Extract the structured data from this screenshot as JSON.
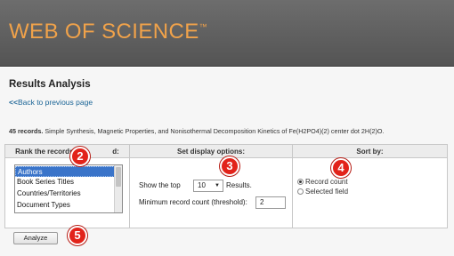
{
  "banner": {
    "title": "WEB OF SCIENCE",
    "trademark": "™"
  },
  "page": {
    "heading": "Results Analysis",
    "back_arrows": "<<",
    "back_link": "Back to previous page"
  },
  "records": {
    "count": "45 records.",
    "title": "Simple Synthesis, Magnetic Properties, and Nonisothermal Decomposition Kinetics of Fe(H2PO4)(2) center dot 2H(2)O."
  },
  "rank": {
    "header_before": "Rank the records by",
    "header_after": "d:",
    "fields": [
      {
        "label": "Authors",
        "selected": true
      },
      {
        "label": "Book Series Titles",
        "selected": false
      },
      {
        "label": "Countries/Territories",
        "selected": false
      },
      {
        "label": "Document Types",
        "selected": false
      }
    ]
  },
  "display": {
    "header": "Set display options:",
    "show_prefix": "Show the top",
    "top_value": "10",
    "top_caret": "▼",
    "show_suffix": "Results.",
    "threshold_label": "Minimum record count (threshold):",
    "threshold_value": "2"
  },
  "sort": {
    "header": "Sort by:",
    "options": [
      {
        "label": "Record count",
        "checked": true
      },
      {
        "label": "Selected field",
        "checked": false
      }
    ]
  },
  "analyze_label": "Analyze",
  "callouts": [
    "2",
    "3",
    "4",
    "5"
  ],
  "colors": {
    "banner_bg": "#5e5e5e",
    "banner_title": "#f0a24a",
    "link": "#1a6496",
    "selected": "#3a74c9",
    "callout": "#e2231a"
  }
}
